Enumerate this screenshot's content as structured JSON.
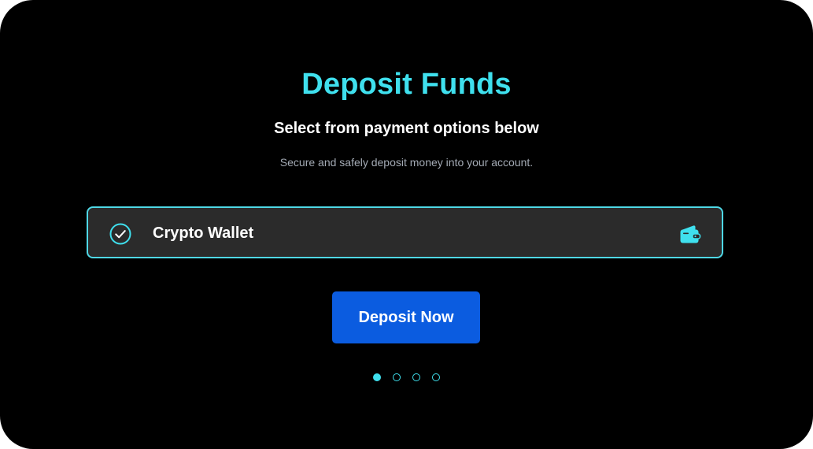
{
  "page": {
    "title": "Deposit Funds",
    "subtitle": "Select from payment options below",
    "helper": "Secure and safely deposit money into your account."
  },
  "payment_option": {
    "label": "Crypto Wallet",
    "selected": true,
    "status_icon": "check-circle-icon",
    "type_icon": "wallet-icon"
  },
  "actions": {
    "deposit_label": "Deposit Now"
  },
  "pagination": {
    "total": 4,
    "active_index": 0
  },
  "colors": {
    "background": "#000000",
    "accent": "#3fe0ee",
    "option_background": "#2b2b2b",
    "option_border": "#4fd8e6",
    "button": "#0b5ce0",
    "helper_text": "#a3aab4"
  }
}
